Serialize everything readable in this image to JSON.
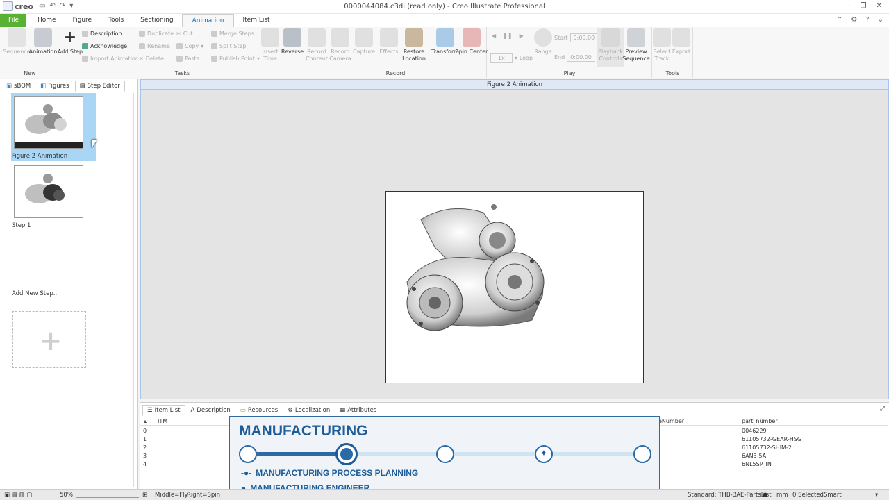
{
  "window": {
    "logo": "creo",
    "title": "0000044084.c3di (read only) - Creo Illustrate Professional"
  },
  "tabs": [
    "File",
    "Home",
    "Figure",
    "Tools",
    "Sectioning",
    "Animation",
    "Item List"
  ],
  "ribbon": {
    "new": {
      "label": "New",
      "sequence": "Sequence",
      "animation": "Animation"
    },
    "tasks": {
      "label": "Tasks",
      "add_step": "Add Step",
      "description": "Description",
      "acknowledge": "Acknowledge",
      "import_animation": "Import Animation",
      "duplicate": "Duplicate",
      "rename": "Rename",
      "delete": "Delete",
      "cut": "Cut",
      "copy": "Copy",
      "paste": "Paste",
      "merge_steps": "Merge Steps",
      "split_step": "Split Step",
      "publish_point": "Publish Point",
      "insert_time": "Insert Time",
      "reverse": "Reverse"
    },
    "record": {
      "label": "Record",
      "record_content": "Record Content",
      "record_camera": "Record Camera",
      "capture": "Capture",
      "effects": "Effects",
      "restore_location": "Restore Location",
      "transform": "Transform",
      "spin_center": "Spin Center"
    },
    "play": {
      "label": "Play",
      "speed": "1x",
      "loop": "Loop",
      "range": "Range",
      "start_label": "Start",
      "start_value": "0:00.00",
      "end_label": "End",
      "end_value": "0:00.00",
      "playback_controls": "Playback Controls",
      "preview_sequence": "Preview Sequence"
    },
    "tools": {
      "label": "Tools",
      "select_track": "Select Track",
      "export": "Export"
    }
  },
  "left_panel": {
    "tabs": [
      "sBOM",
      "Figures",
      "Step Editor"
    ],
    "items": [
      "Figure 2 Animation",
      "Step 1"
    ],
    "add_new": "Add New Step..."
  },
  "viewport": {
    "title": "Figure 2 Animation"
  },
  "bottom_panel": {
    "tabs": [
      "Item List",
      "Description",
      "Resources",
      "Localization",
      "Attributes"
    ],
    "columns": {
      "itm": "ITM",
      "number": "eNumber",
      "part_number": "part_number"
    },
    "rows": [
      {
        "index": "0",
        "part_number": "0046229"
      },
      {
        "index": "1",
        "part_number": "61105732-GEAR-HSG"
      },
      {
        "index": "2",
        "part_number": "61105732-SHIM-2"
      },
      {
        "index": "3",
        "part_number": "6AN3-5A"
      },
      {
        "index": "4",
        "part_number": "6NL5SP_IN"
      }
    ]
  },
  "overlay": {
    "title": "MANUFACTURING",
    "line1": "MANUFACTURING PROCESS PLANNING",
    "line2": "MANUFACTURING ENGINEER",
    "progress_step": 2,
    "progress_total": 5
  },
  "status": {
    "zoom": "50%",
    "mouse": "Middle=Fly",
    "mouse2": "Right=Spin",
    "standard": "Standard: THB-BAE-PartsList",
    "unit": "mm",
    "selected": "0 Selected",
    "mode": "Smart"
  },
  "colors": {
    "accent": "#0a72c4",
    "file_tab": "#58b133",
    "overlay_blue": "#1e5d99"
  }
}
